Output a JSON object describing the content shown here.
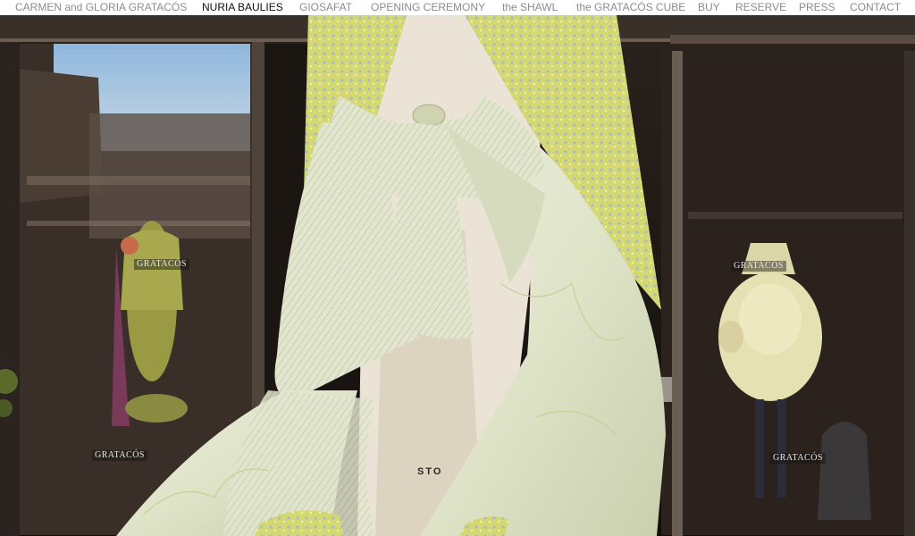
{
  "nav": {
    "items": [
      {
        "label": "CARMEN and GLORIA GRATACÓS",
        "active": false
      },
      {
        "label": "NURIA BAULIES",
        "active": true
      },
      {
        "label": "GIOSAFAT",
        "active": false
      },
      {
        "label": "OPENING CEREMONY",
        "active": false
      },
      {
        "label": "the SHAWL",
        "active": false
      },
      {
        "label": "the GRATACÓS CUBE",
        "active": false
      },
      {
        "label": "BUY",
        "active": false
      },
      {
        "label": "RESERVE",
        "active": false
      },
      {
        "label": "PRESS",
        "active": false
      },
      {
        "label": "CONTACT",
        "active": false
      }
    ]
  },
  "hero": {
    "window_signs": [
      "GRATACÓS",
      "GRATACÓS",
      "GRATACÓS",
      "GRATACÓS"
    ],
    "mannequin_stamp": "STO"
  },
  "colors": {
    "nav_text": "#8c8c8c",
    "nav_active": "#111111",
    "fabric_cream": "#e6e9d2",
    "fabric_yellow": "#d6d871"
  }
}
